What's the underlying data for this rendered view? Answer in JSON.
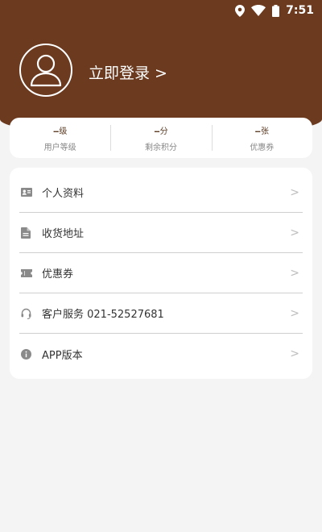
{
  "status_bar": {
    "time": "7:51",
    "icons": [
      "location-icon",
      "wifi-icon",
      "battery-icon"
    ]
  },
  "header": {
    "login_label": "立即登录 >",
    "avatar_icon": "user-avatar-icon",
    "background_color": "#6b3a1f"
  },
  "stats": [
    {
      "value": "--",
      "unit": "级",
      "label": "用户等级"
    },
    {
      "value": "--",
      "unit": "分",
      "label": "剩余积分"
    },
    {
      "value": "--",
      "unit": "张",
      "label": "优惠券"
    }
  ],
  "menu": [
    {
      "label": "个人资料",
      "icon": "id-card-icon"
    },
    {
      "label": "收货地址",
      "icon": "document-icon"
    },
    {
      "label": "优惠券",
      "icon": "ticket-icon"
    },
    {
      "label": "客户服务 021-52527681",
      "icon": "headset-icon"
    },
    {
      "label": "APP版本",
      "icon": "info-icon"
    }
  ],
  "arrow_glyph": ">"
}
